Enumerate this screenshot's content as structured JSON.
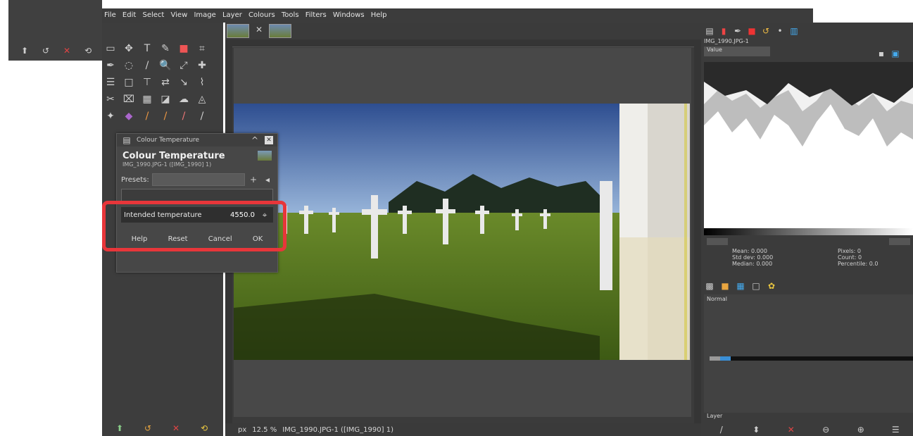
{
  "menubar": {
    "items": [
      "File",
      "Edit",
      "Select",
      "View",
      "Image",
      "Layer",
      "Colours",
      "Tools",
      "Filters",
      "Windows",
      "Help"
    ]
  },
  "dialog": {
    "title": "Colour Temperature",
    "header_title": "Colour Temperature",
    "header_sub": "IMG_1990.JPG-1 ([IMG_1990] 1)",
    "presets_label": "Presets:",
    "intended_label": "Intended temperature",
    "intended_value": "4550.0",
    "buttons": [
      "Help",
      "Reset",
      "Cancel",
      "OK"
    ]
  },
  "status": {
    "units": "px",
    "zoom": "12.5 %",
    "info": "IMG_1990.JPG-1 ([IMG_1990] 1)"
  },
  "right_panel": {
    "header": "IMG_1990.JPG-1",
    "channel": "Value",
    "stats_left": [
      "Mean: 0.000",
      "Std dev: 0.000",
      "Median: 0.000"
    ],
    "stats_right": [
      "Pixels: 0",
      "Count: 0",
      "Percentile: 0.0"
    ]
  },
  "layers": {
    "mode_label": "Normal",
    "bottom_label": "Layer"
  },
  "colors": {
    "highlight": "#e8363a",
    "panel": "#3b3b3b",
    "menubar": "#3c3c3c"
  }
}
